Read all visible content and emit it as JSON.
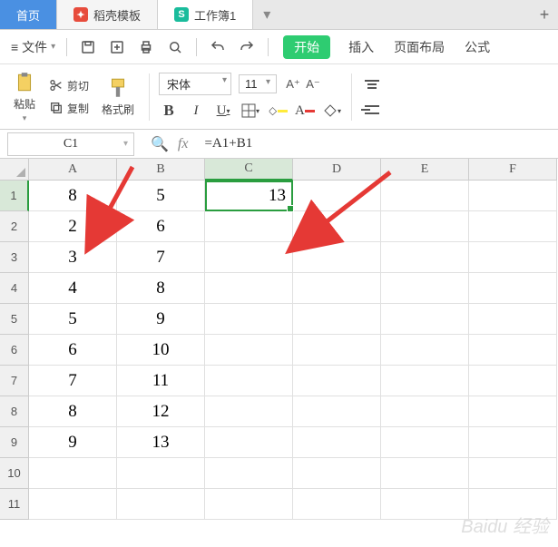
{
  "tabs": {
    "home": "首页",
    "docer": "稻壳模板",
    "workbook": "工作簿1"
  },
  "quickbar": {
    "file_menu": "文件"
  },
  "menu": {
    "start": "开始",
    "insert": "插入",
    "page_layout": "页面布局",
    "formula": "公式"
  },
  "ribbon": {
    "paste": "粘贴",
    "cut": "剪切",
    "copy": "复制",
    "format_painter": "格式刷",
    "font_name": "宋体",
    "font_size": "11"
  },
  "formula_bar": {
    "cell_ref": "C1",
    "formula": "=A1+B1"
  },
  "columns": [
    "A",
    "B",
    "C",
    "D",
    "E",
    "F"
  ],
  "rows": [
    "1",
    "2",
    "3",
    "4",
    "5",
    "6",
    "7",
    "8",
    "9",
    "10",
    "11"
  ],
  "active_cell": {
    "col": 2,
    "row": 0,
    "display": "13"
  },
  "data": [
    [
      "8",
      "5",
      "13",
      "",
      "",
      ""
    ],
    [
      "2",
      "6",
      "",
      "",
      "",
      ""
    ],
    [
      "3",
      "7",
      "",
      "",
      "",
      ""
    ],
    [
      "4",
      "8",
      "",
      "",
      "",
      ""
    ],
    [
      "5",
      "9",
      "",
      "",
      "",
      ""
    ],
    [
      "6",
      "10",
      "",
      "",
      "",
      ""
    ],
    [
      "7",
      "11",
      "",
      "",
      "",
      ""
    ],
    [
      "8",
      "12",
      "",
      "",
      "",
      ""
    ],
    [
      "9",
      "13",
      "",
      "",
      "",
      ""
    ],
    [
      "",
      "",
      "",
      "",
      "",
      ""
    ],
    [
      "",
      "",
      "",
      "",
      "",
      ""
    ]
  ],
  "watermark": "Baidu 经验",
  "chart_data": {
    "type": "table",
    "columns": [
      "A",
      "B",
      "C"
    ],
    "rows": [
      [
        8,
        5,
        13
      ],
      [
        2,
        6,
        null
      ],
      [
        3,
        7,
        null
      ],
      [
        4,
        8,
        null
      ],
      [
        5,
        9,
        null
      ],
      [
        6,
        10,
        null
      ],
      [
        7,
        11,
        null
      ],
      [
        8,
        12,
        null
      ],
      [
        9,
        13,
        null
      ]
    ],
    "formula": "C1 = A1 + B1"
  }
}
